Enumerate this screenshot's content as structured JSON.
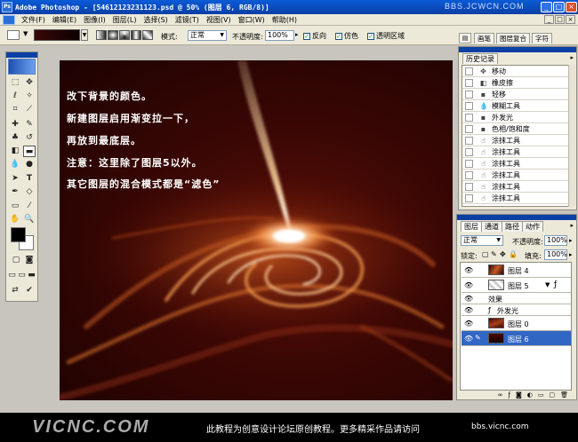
{
  "titlebar": {
    "app_name": "Adobe Photoshop",
    "document": "[54612123231123.psd @ 50% (图层 6, RGB/8)]",
    "watermark": "BBS.JCWCN.COM"
  },
  "menubar": {
    "items": [
      "文件(F)",
      "编辑(E)",
      "图像(I)",
      "图层(L)",
      "选择(S)",
      "滤镜(T)",
      "视图(V)",
      "窗口(W)",
      "帮助(H)"
    ]
  },
  "options": {
    "mode_label": "模式:",
    "mode_value": "正常",
    "opacity_label": "不透明度:",
    "opacity_value": "100%",
    "reverse_label": "反向",
    "dither_label": "仿色",
    "transparency_label": "透明区域",
    "tabs": [
      "画笔",
      "图层复合",
      "字符"
    ],
    "gradient_color": "#3a0707"
  },
  "canvas": {
    "captions": [
      "改下背景的颜色。",
      "新建图层启用渐变拉一下，",
      "再放到最底层。",
      "注意：这里除了图层5以外。",
      "其它图层的混合模式都是“滤色”"
    ]
  },
  "history": {
    "title": "历史记录",
    "items": [
      {
        "label": "移动",
        "icon": "move-icon"
      },
      {
        "label": "橡皮擦",
        "icon": "eraser-icon"
      },
      {
        "label": "轻移",
        "icon": "nudge-icon"
      },
      {
        "label": "模糊工具",
        "icon": "blur-icon"
      },
      {
        "label": "外发光",
        "icon": "outer-glow-icon"
      },
      {
        "label": "色相/饱和度",
        "icon": "hue-saturation-icon"
      },
      {
        "label": "涂抹工具",
        "icon": "smudge-icon"
      },
      {
        "label": "涂抹工具",
        "icon": "smudge-icon"
      },
      {
        "label": "涂抹工具",
        "icon": "smudge-icon"
      },
      {
        "label": "涂抹工具",
        "icon": "smudge-icon"
      },
      {
        "label": "涂抹工具",
        "icon": "smudge-icon"
      },
      {
        "label": "涂抹工具",
        "icon": "smudge-icon"
      }
    ]
  },
  "layers": {
    "tabs": [
      "图层",
      "通道",
      "路径",
      "动作"
    ],
    "blend_mode": "正常",
    "opacity_label": "不透明度:",
    "opacity_value": "100%",
    "lock_label": "锁定:",
    "fill_label": "填充:",
    "fill_value": "100%",
    "rows": [
      {
        "name": "图层 4",
        "selected": false
      },
      {
        "name": "图层 5",
        "selected": false
      },
      {
        "name": "效果",
        "selected": false
      },
      {
        "name": "外发光",
        "selected": false
      },
      {
        "name": "图层 0",
        "selected": false
      },
      {
        "name": "图层 6",
        "selected": true
      }
    ]
  },
  "footer": {
    "logo": "VICNC.COM",
    "text": "此教程为创意设计论坛原创教程。更多精采作品请访问",
    "url": "bbs.vicnc.com"
  },
  "colors": {
    "foreground": "#000000",
    "background": "#ffffff",
    "selection": "#3166c5",
    "titlebar": "#0a3fa6"
  }
}
